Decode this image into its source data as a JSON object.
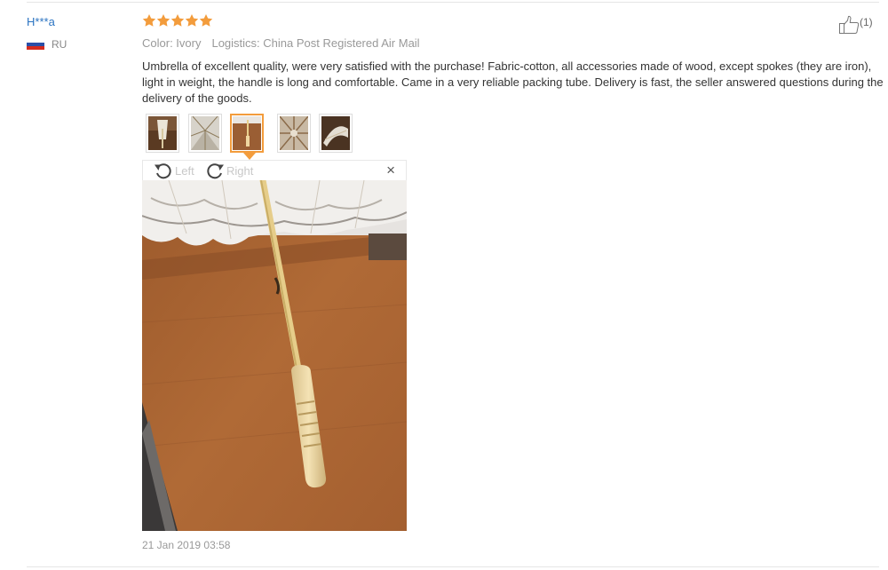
{
  "review": {
    "reviewer_name": "H***a",
    "country_code": "RU",
    "rating": 5,
    "rating_max": 5,
    "color_label": "Color: Ivory",
    "logistics_label": "Logistics: China Post Registered Air Mail",
    "text": "Umbrella of excellent quality, were very satisfied with the purchase! Fabric-cotton, all accessories made of wood, except spokes (they are iron), light in weight, the handle is long and comfortable. Came in a very reliable packing tube. Delivery is fast, the seller answered questions during the delivery of the goods.",
    "helpful_count": "(1)",
    "timestamp": "21 Jan 2019 03:58"
  },
  "viewer": {
    "rotate_left_label": "Left",
    "rotate_right_label": "Right",
    "close_label": "×"
  },
  "thumbnails": {
    "count": 5,
    "active_index": 2
  },
  "colors": {
    "accent": "#f39c3c",
    "link": "#2c74c2",
    "star": "#f39c3c",
    "muted": "#999999"
  },
  "icons": {
    "helpful": "thumbs-up-icon",
    "rotate_left": "rotate-left-icon",
    "rotate_right": "rotate-right-icon",
    "close": "close-icon",
    "rating_star": "star-icon",
    "country": "russia-flag-icon"
  }
}
